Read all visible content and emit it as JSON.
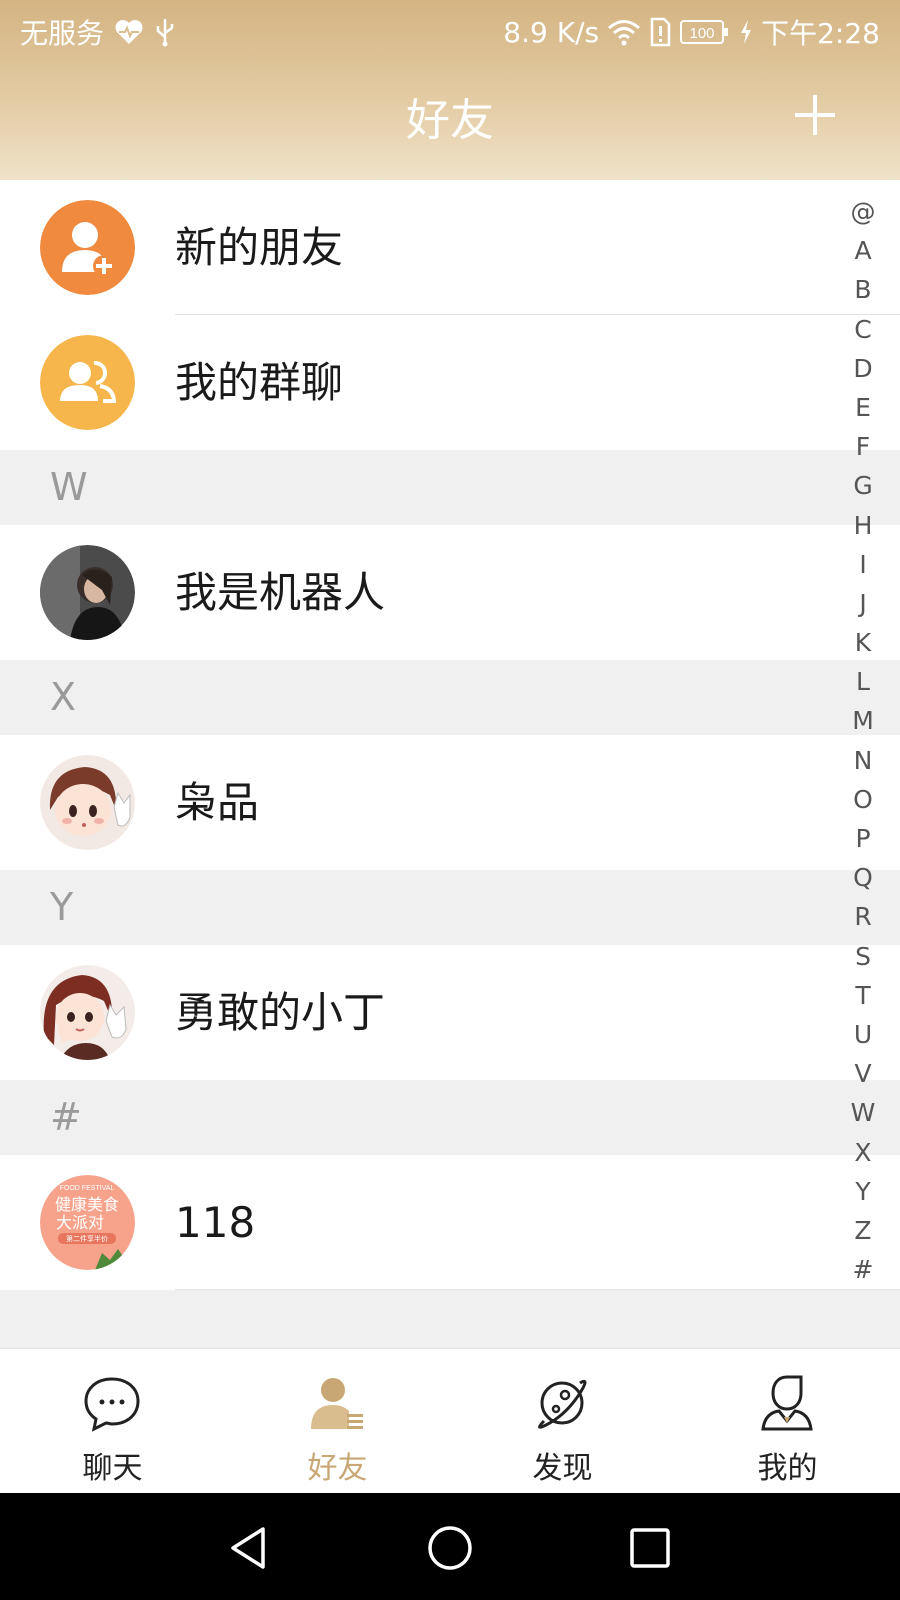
{
  "status_bar": {
    "carrier": "无服务",
    "speed": "8.9 K/s",
    "battery": "100",
    "time": "下午2:28"
  },
  "header": {
    "title": "好友"
  },
  "fixed_items": [
    {
      "label": "新的朋友"
    },
    {
      "label": "我的群聊"
    }
  ],
  "sections": [
    {
      "letter": "W",
      "contact": "我是机器人"
    },
    {
      "letter": "X",
      "contact": "枭品"
    },
    {
      "letter": "Y",
      "contact": "勇敢的小丁"
    },
    {
      "letter": "#",
      "contact": "118"
    }
  ],
  "avatar_118": {
    "top_text": "FOOD FESTIVAL",
    "line1": "健康美食",
    "line2": "大派对",
    "line3": "第二件享半价"
  },
  "index": [
    "@",
    "A",
    "B",
    "C",
    "D",
    "E",
    "F",
    "G",
    "H",
    "I",
    "J",
    "K",
    "L",
    "M",
    "N",
    "O",
    "P",
    "Q",
    "R",
    "S",
    "T",
    "U",
    "V",
    "W",
    "X",
    "Y",
    "Z",
    "#"
  ],
  "tabs": [
    {
      "label": "聊天",
      "icon": "chat-bubble-icon"
    },
    {
      "label": "好友",
      "icon": "friends-icon",
      "active": true
    },
    {
      "label": "发现",
      "icon": "planet-icon"
    },
    {
      "label": "我的",
      "icon": "profile-icon"
    }
  ],
  "colors": {
    "header_gradient": [
      "#d4b483",
      "#efe2c9"
    ],
    "accent": "#c9a774",
    "new_friend_avatar": "#ef8a3e",
    "group_avatar": "#f7b64b"
  }
}
